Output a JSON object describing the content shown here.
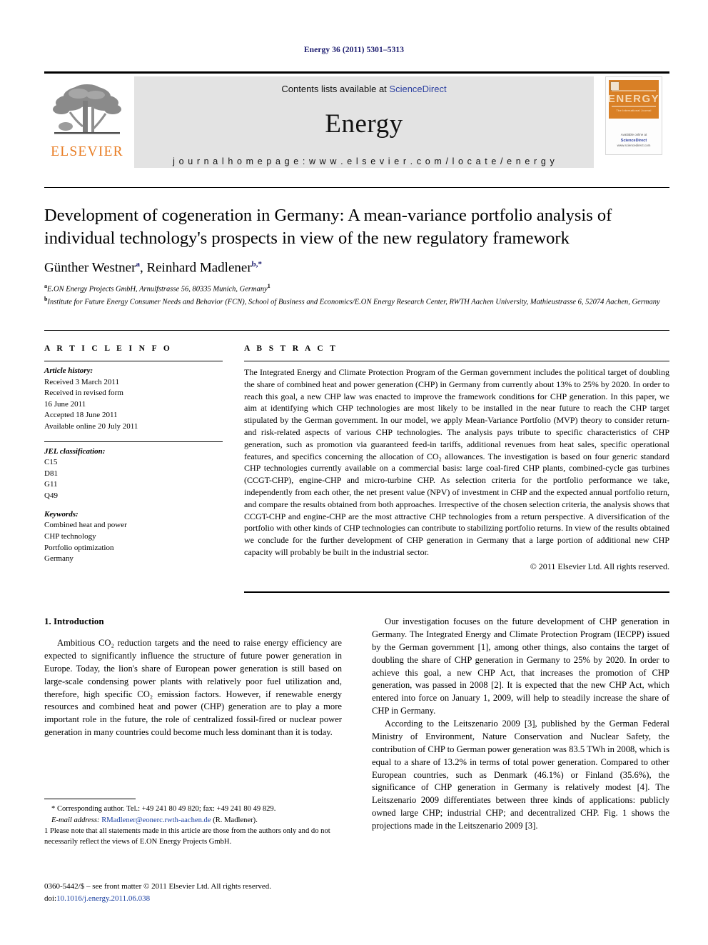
{
  "running_head": "Energy 36 (2011) 5301–5313",
  "masthead": {
    "contents_prefix": "Contents lists available at ",
    "sciencedirect": "ScienceDirect",
    "journal_name": "Energy",
    "homepage": "j o u r n a l   h o m e p a g e :   w w w . e l s e v i e r . c o m / l o c a t e / e n e r g y",
    "publisher_word": "ELSEVIER",
    "publisher_color": "#e87b21",
    "link_color": "#2b3fa0",
    "cover": {
      "title": "ENERGY",
      "subtitle": "The International Journal",
      "available_at": "Available online at",
      "sciencedirect": "ScienceDirect",
      "url": "www.sciencedirect.com"
    }
  },
  "title": "Development of cogeneration in Germany: A mean-variance portfolio analysis of individual technology's prospects in view of the new regulatory framework",
  "authors": [
    {
      "name": "Günther Westner",
      "marker": "a"
    },
    {
      "name": "Reinhard Madlener",
      "marker": "b,*"
    }
  ],
  "affiliations": [
    {
      "marker": "a",
      "text": "E.ON Energy Projects GmbH, Arnulfstrasse 56, 80335 Munich, Germany",
      "note": "1"
    },
    {
      "marker": "b",
      "text": "Institute for Future Energy Consumer Needs and Behavior (FCN), School of Business and Economics/E.ON Energy Research Center, RWTH Aachen University, Mathieustrasse 6, 52074 Aachen, Germany",
      "note": ""
    }
  ],
  "article_info": {
    "heading": "A R T I C L E   I N F O",
    "history_label": "Article history:",
    "history": [
      "Received 3 March 2011",
      "Received in revised form",
      "16 June 2011",
      "Accepted 18 June 2011",
      "Available online 20 July 2011"
    ],
    "jel_label": "JEL classification:",
    "jel_codes": [
      "C15",
      "D81",
      "G11",
      "Q49"
    ],
    "keywords_label": "Keywords:",
    "keywords": [
      "Combined heat and power",
      "CHP technology",
      "Portfolio optimization",
      "Germany"
    ]
  },
  "abstract": {
    "heading": "A B S T R A C T",
    "text": "The Integrated Energy and Climate Protection Program of the German government includes the political target of doubling the share of combined heat and power generation (CHP) in Germany from currently about 13% to 25% by 2020. In order to reach this goal, a new CHP law was enacted to improve the framework conditions for CHP generation. In this paper, we aim at identifying which CHP technologies are most likely to be installed in the near future to reach the CHP target stipulated by the German government. In our model, we apply Mean-Variance Portfolio (MVP) theory to consider return- and risk-related aspects of various CHP technologies. The analysis pays tribute to specific characteristics of CHP generation, such as promotion via guaranteed feed-in tariffs, additional revenues from heat sales, specific operational features, and specifics concerning the allocation of CO₂ allowances. The investigation is based on four generic standard CHP technologies currently available on a commercial basis: large coal-fired CHP plants, combined-cycle gas turbines (CCGT-CHP), engine-CHP and micro-turbine CHP. As selection criteria for the portfolio performance we take, independently from each other, the net present value (NPV) of investment in CHP and the expected annual portfolio return, and compare the results obtained from both approaches. Irrespective of the chosen selection criteria, the analysis shows that CCGT-CHP and engine-CHP are the most attractive CHP technologies from a return perspective. A diversification of the portfolio with other kinds of CHP technologies can contribute to stabilizing portfolio returns. In view of the results obtained we conclude for the further development of CHP generation in Germany that a large portion of additional new CHP capacity will probably be built in the industrial sector.",
    "copyright": "© 2011 Elsevier Ltd. All rights reserved."
  },
  "introduction": {
    "heading": "1. Introduction",
    "left_paragraph": "Ambitious CO₂ reduction targets and the need to raise energy efficiency are expected to significantly influence the structure of future power generation in Europe. Today, the lion's share of European power generation is still based on large-scale condensing power plants with relatively poor fuel utilization and, therefore, high specific CO₂ emission factors. However, if renewable energy resources and combined heat and power (CHP) generation are to play a more important role in the future, the role of centralized fossil-fired or nuclear power generation in many countries could become much less dominant than it is today.",
    "right_paragraph_1": "Our investigation focuses on the future development of CHP generation in Germany. The Integrated Energy and Climate Protection Program (IECPP) issued by the German government [1], among other things, also contains the target of doubling the share of CHP generation in Germany to 25% by 2020. In order to achieve this goal, a new CHP Act, that increases the promotion of CHP generation, was passed in 2008 [2]. It is expected that the new CHP Act, which entered into force on January 1, 2009, will help to steadily increase the share of CHP in Germany.",
    "right_paragraph_2": "According to the Leitszenario 2009 [3], published by the German Federal Ministry of Environment, Nature Conservation and Nuclear Safety, the contribution of CHP to German power generation was 83.5 TWh in 2008, which is equal to a share of 13.2% in terms of total power generation. Compared to other European countries, such as Denmark (46.1%) or Finland (35.6%), the significance of CHP generation in Germany is relatively modest [4]. The Leitszenario 2009 differentiates between three kinds of applications: publicly owned large CHP; industrial CHP; and decentralized CHP. Fig. 1 shows the projections made in the Leitszenario 2009 [3]."
  },
  "footnotes": {
    "corresponding": "* Corresponding author. Tel.: +49 241 80 49 820; fax: +49 241 80 49 829.",
    "email_label": "E-mail address:",
    "email": "RMadlener@eonerc.rwth-aachen.de",
    "email_suffix": "(R. Madlener).",
    "note1": "1  Please note that all statements made in this article are those from the authors only and do not necessarily reflect the views of E.ON Energy Projects GmbH."
  },
  "imprint": {
    "line1": "0360-5442/$ – see front matter © 2011 Elsevier Ltd. All rights reserved.",
    "doi_label": "doi:",
    "doi": "10.1016/j.energy.2011.06.038"
  }
}
